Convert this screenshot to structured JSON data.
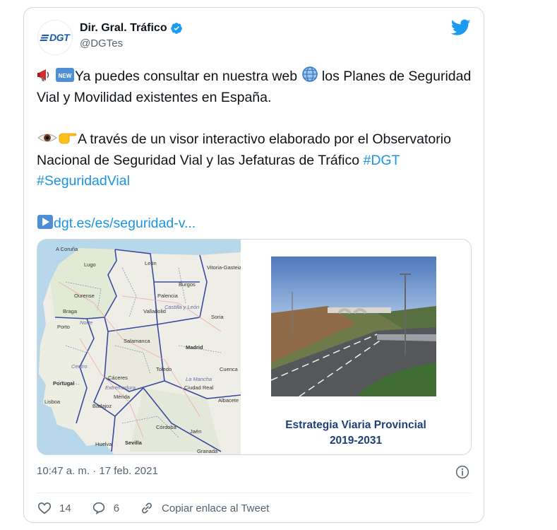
{
  "author": {
    "name": "Dir. Gral. Tráfico",
    "handle": "@DGTes",
    "avatar_text": "DGT"
  },
  "tweet": {
    "para1_a": "Ya puedes consultar en nuestra web ",
    "para1_b": " los Planes de Seguridad Vial y Movilidad existentes en España.",
    "para2_text": "A través de un visor interactivo elaborado por el Observatorio Nacional de Seguridad Vial y las Jefaturas de Tráfico ",
    "hashtags": [
      "#DGT",
      "#SeguridadVial"
    ],
    "link": "dgt.es/es/seguridad-v..."
  },
  "media": {
    "cover_title_line1": "Estrategia Viaria Provincial",
    "cover_title_line2": "2019-2031",
    "map_labels": {
      "coruna": "A Coruña",
      "lugo": "Lugo",
      "ourense": "Ourense",
      "braga": "Braga",
      "porto": "Porto",
      "leon": "León",
      "palencia": "Palencia",
      "burgos": "Burgos",
      "vitoria": "Vitoria-Gasteiz",
      "valladolid": "Valladolid",
      "castilla": "Castilla y León",
      "salamanca": "Salamanca",
      "madrid": "Madrid",
      "toledo": "Toledo",
      "caceres": "Cáceres",
      "extremadura": "Extremadura",
      "merida": "Mérida",
      "badajoz": "Badajoz",
      "portugal": "Portugal",
      "lisboa": "Lisboa",
      "ciudad_real": "Ciudad Real",
      "albacete": "Albacete",
      "cordoba": "Córdoba",
      "jaen": "Jaén",
      "sevilla": "Sevilla",
      "granada": "Granada",
      "huelva": "Huelva",
      "centro": "Centro",
      "norte": "Norte",
      "mancha": "La Mancha",
      "soria": "Soria",
      "cuenca": "Cuenca"
    }
  },
  "meta": {
    "timestamp": "10:47 a. m. · 17 feb. 2021"
  },
  "actions": {
    "likes": "14",
    "replies": "6",
    "copy_link": "Copiar enlace al Tweet"
  },
  "colors": {
    "accent": "#1b95e0",
    "text": "#0f1419",
    "muted": "#536471",
    "border": "#cfd9de"
  }
}
